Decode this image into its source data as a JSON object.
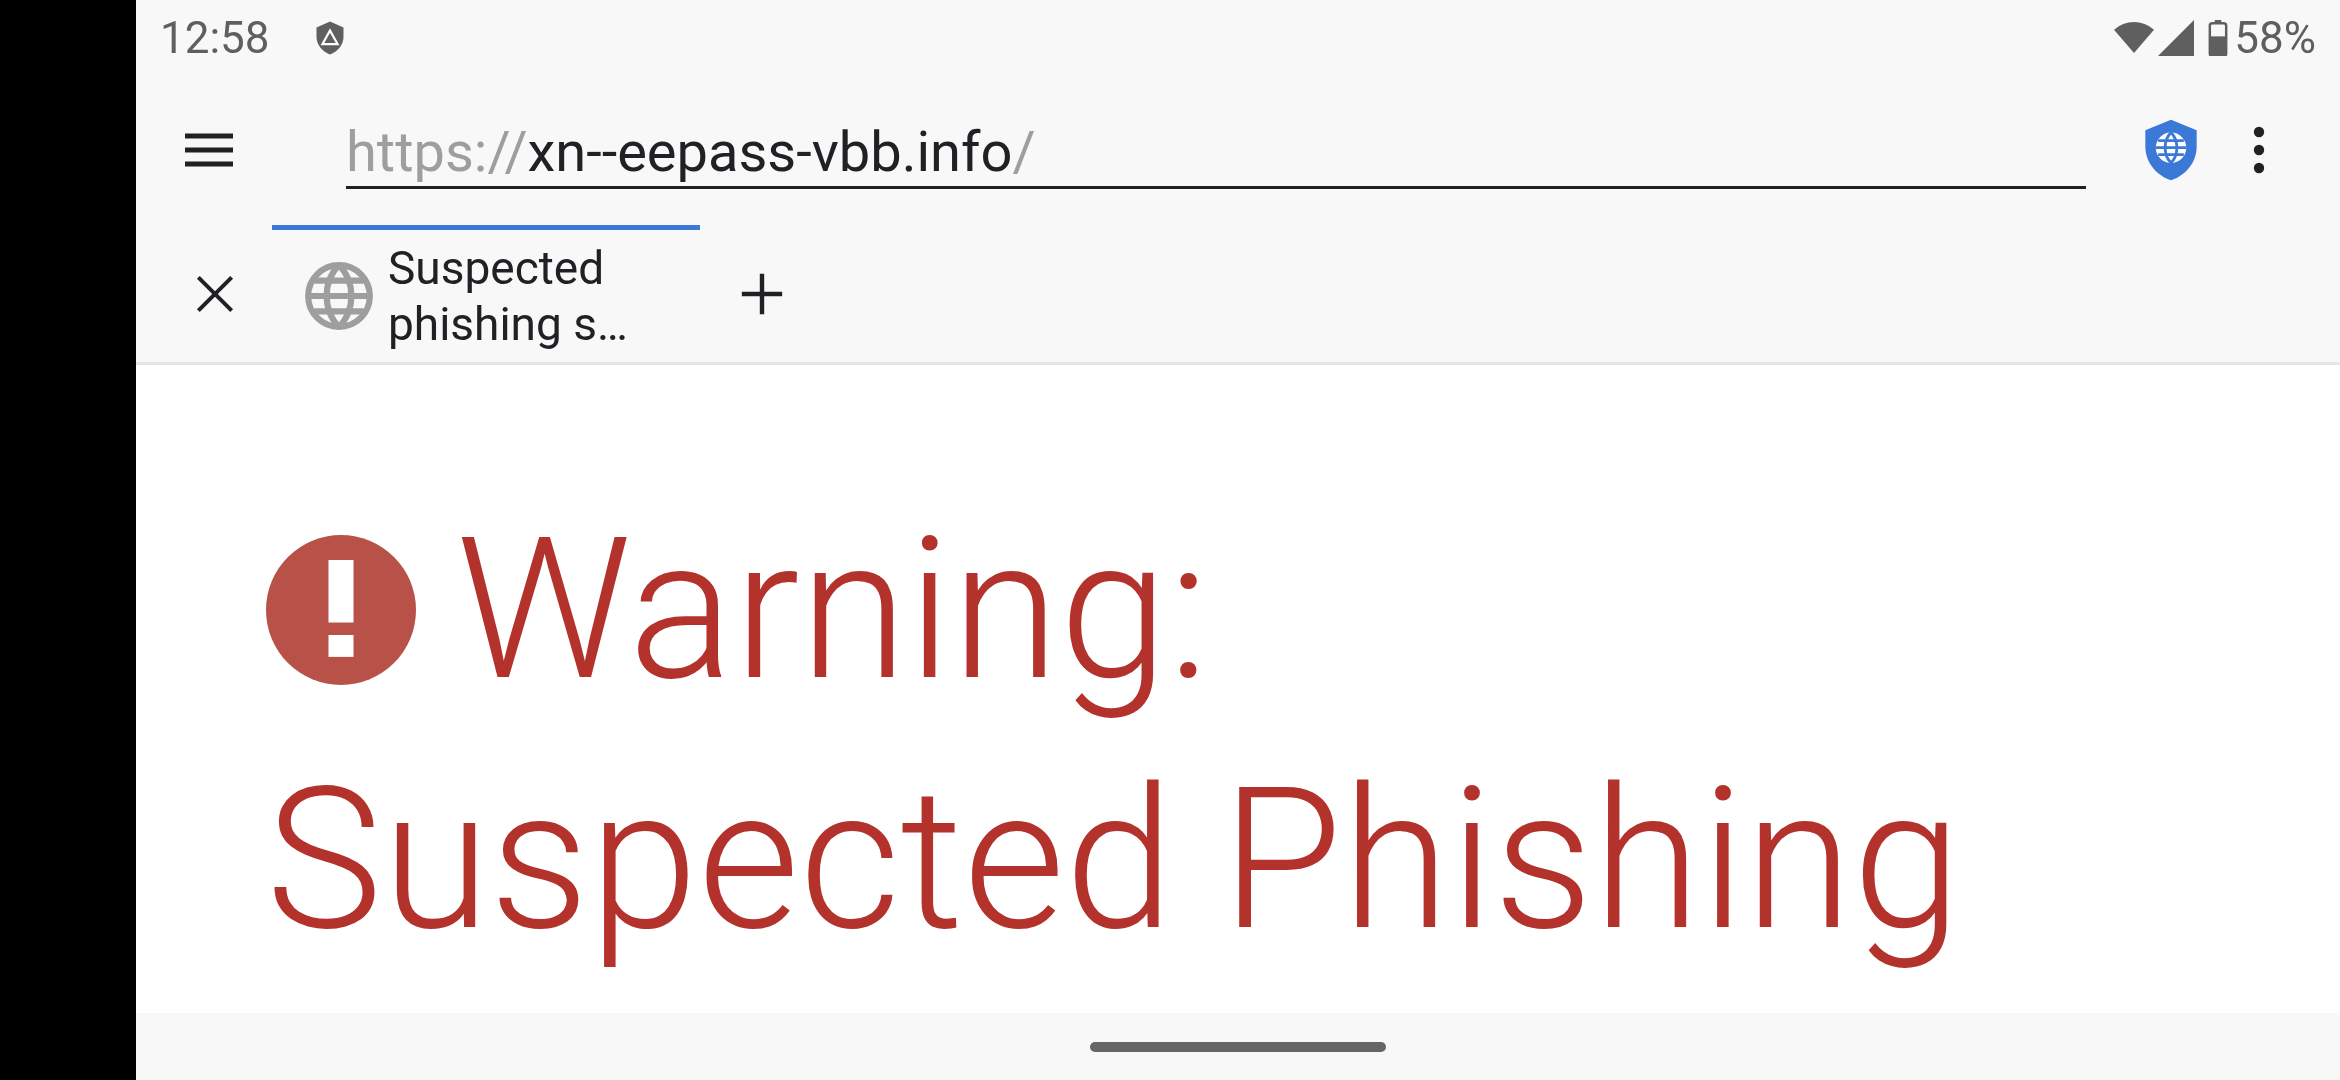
{
  "status_bar": {
    "time": "12:58",
    "battery": "58%"
  },
  "address_bar": {
    "scheme": "https://",
    "host": "xn--eepass-vbb.info",
    "path": "/"
  },
  "tabs": [
    {
      "title": "Suspected phishing s…",
      "selected": true
    }
  ],
  "heading_lines": [
    "Warning:",
    "Suspected Phishing"
  ]
}
